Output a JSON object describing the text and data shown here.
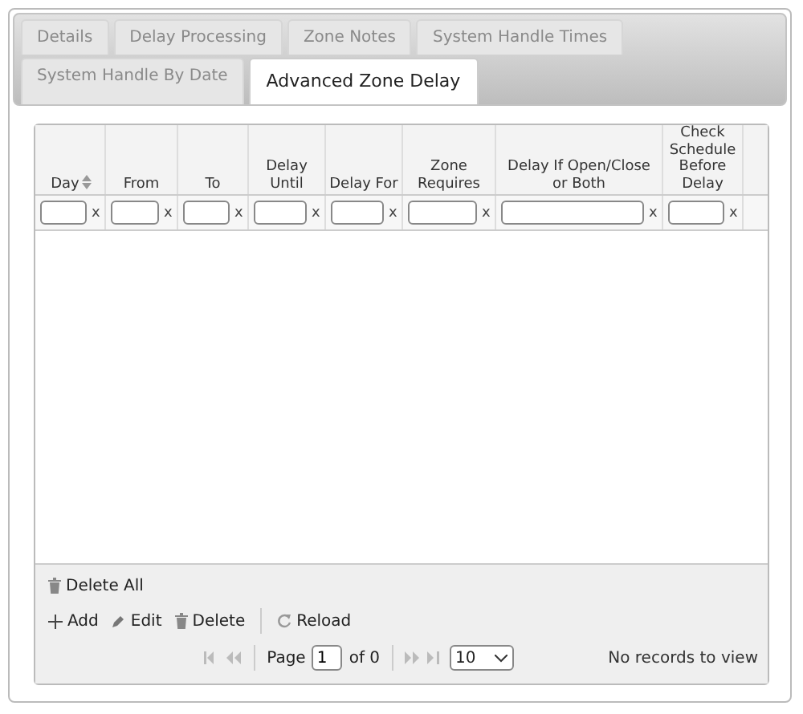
{
  "tab_rows": [
    {
      "tabs": [
        {
          "label": "Details",
          "selected": false
        },
        {
          "label": "Delay Processing",
          "selected": false
        },
        {
          "label": "Zone Notes",
          "selected": false
        },
        {
          "label": "System Handle Times",
          "selected": false
        }
      ]
    },
    {
      "tabs": [
        {
          "label": "System Handle By Date",
          "selected": false
        },
        {
          "label": "Advanced Zone Delay",
          "selected": true
        }
      ]
    }
  ],
  "table": {
    "columns": [
      {
        "label": "Day",
        "sortable": true,
        "clear": "x"
      },
      {
        "label": "From",
        "sortable": false,
        "clear": "x"
      },
      {
        "label": "To",
        "sortable": false,
        "clear": "x"
      },
      {
        "label": "Delay Until",
        "sortable": false,
        "clear": "x"
      },
      {
        "label": "Delay For",
        "sortable": false,
        "clear": "x"
      },
      {
        "label": "Zone Requires",
        "sortable": false,
        "clear": "x"
      },
      {
        "label": "Delay If Open/Close or Both",
        "sortable": false,
        "clear": "x"
      },
      {
        "label": "Check Schedule Before Delay",
        "sortable": false,
        "clear": "x"
      }
    ]
  },
  "actions": [
    {
      "kind": "delete",
      "label": "Delete All"
    }
  ],
  "toolbar": [
    {
      "kind": "add",
      "label": "Add"
    },
    {
      "kind": "edit",
      "label": "Edit"
    },
    {
      "kind": "delete",
      "label": "Delete"
    },
    {
      "kind": "reload",
      "label": "Reload"
    }
  ],
  "pager": {
    "page_label": "Page",
    "page": "1",
    "of_label": "of 0",
    "page_size": "10",
    "status": "No records to view"
  }
}
